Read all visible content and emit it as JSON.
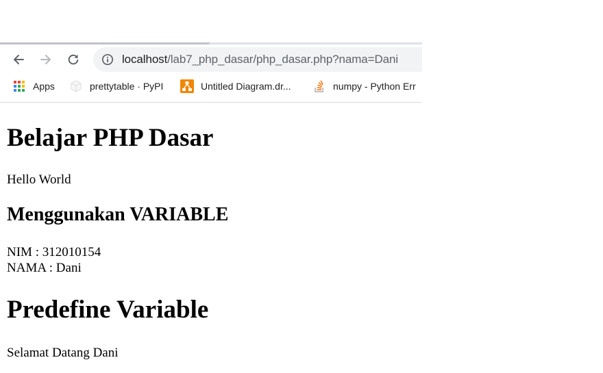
{
  "browser": {
    "address_bar": {
      "host": "localhost",
      "path": "/lab7_php_dasar/php_dasar.php?nama=Dani"
    },
    "bookmarks": [
      {
        "label": "Apps",
        "icon": "apps-grid-icon"
      },
      {
        "label": "prettytable · PyPI",
        "icon": "pypi-cube-icon"
      },
      {
        "label": "Untitled Diagram.dr...",
        "icon": "drawio-icon"
      },
      {
        "label": "numpy - Python Err",
        "icon": "stackoverflow-icon"
      }
    ]
  },
  "page": {
    "heading1": "Belajar PHP Dasar",
    "hello": "Hello World",
    "heading2": "Menggunakan VARIABLE",
    "nim_line": "NIM : 312010154",
    "nama_line": "NAMA : Dani",
    "heading3": "Predefine Variable",
    "welcome": "Selamat Datang Dani"
  },
  "colors": {
    "omnibox_bg": "#f1f3f4",
    "icon_gray": "#5f6368",
    "drawio_orange": "#f08705",
    "stackoverflow_orange": "#f48024"
  }
}
